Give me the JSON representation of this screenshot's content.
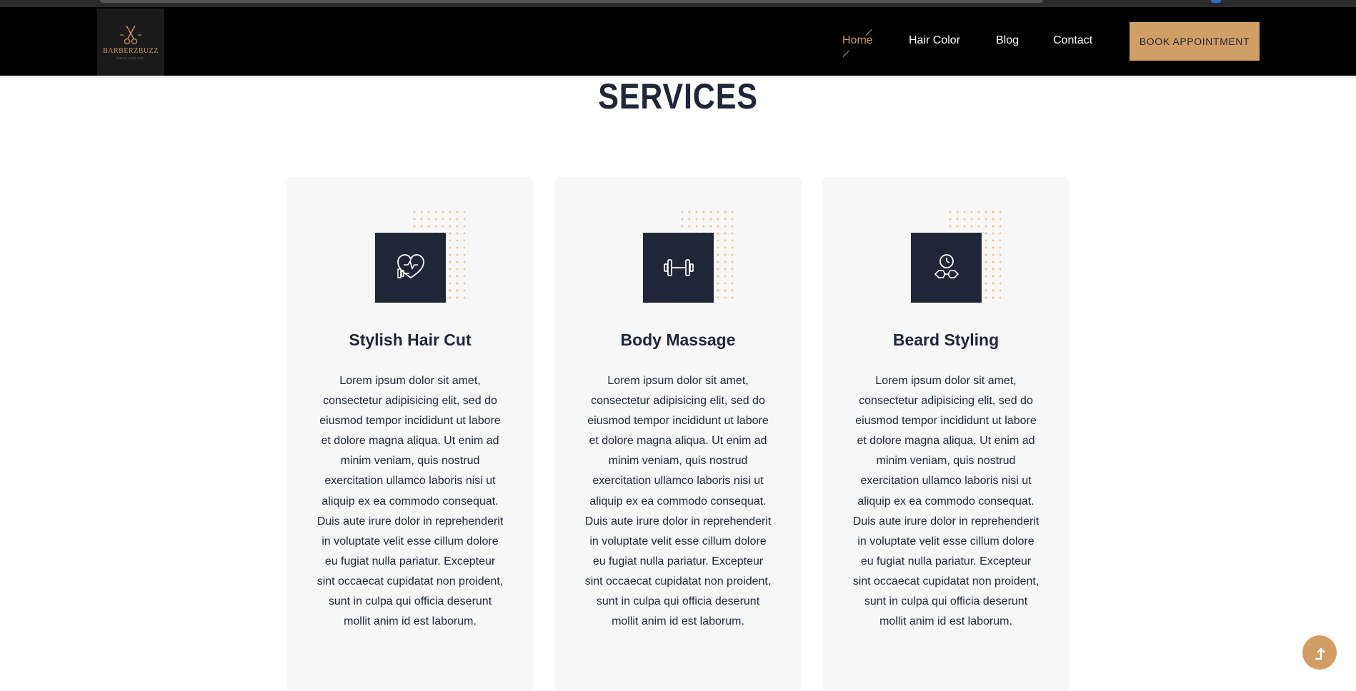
{
  "brand": {
    "name": "BARBERZBUZZ",
    "tagline": "SINCE 2020 EST."
  },
  "nav": {
    "items": [
      {
        "label": "Home",
        "active": true
      },
      {
        "label": "Hair Color",
        "active": false
      },
      {
        "label": "Blog",
        "active": false
      },
      {
        "label": "Contact",
        "active": false
      }
    ],
    "cta": "BOOK APPOINTMENT"
  },
  "services": {
    "title": "SERVICES",
    "cards": [
      {
        "icon": "heart-dumbbell-icon",
        "title": "Stylish Hair Cut",
        "text": "Lorem ipsum dolor sit amet, consectetur adipisicing elit, sed do eiusmod tempor incididunt ut labore et dolore magna aliqua. Ut enim ad minim veniam, quis nostrud exercitation ullamco laboris nisi ut aliquip ex ea commodo consequat. Duis aute irure dolor in reprehenderit in voluptate velit esse cillum dolore eu fugiat nulla pariatur. Excepteur sint occaecat cupidatat non proident, sunt in culpa qui officia deserunt mollit anim id est laborum."
      },
      {
        "icon": "dumbbell-icon",
        "title": "Body Massage",
        "text": "Lorem ipsum dolor sit amet, consectetur adipisicing elit, sed do eiusmod tempor incididunt ut labore et dolore magna aliqua. Ut enim ad minim veniam, quis nostrud exercitation ullamco laboris nisi ut aliquip ex ea commodo consequat. Duis aute irure dolor in reprehenderit in voluptate velit esse cillum dolore eu fugiat nulla pariatur. Excepteur sint occaecat cupidatat non proident, sunt in culpa qui officia deserunt mollit anim id est laborum."
      },
      {
        "icon": "stopwatch-dumbbell-icon",
        "title": "Beard Styling",
        "text": "Lorem ipsum dolor sit amet, consectetur adipisicing elit, sed do eiusmod tempor incididunt ut labore et dolore magna aliqua. Ut enim ad minim veniam, quis nostrud exercitation ullamco laboris nisi ut aliquip ex ea commodo consequat. Duis aute irure dolor in reprehenderit in voluptate velit esse cillum dolore eu fugiat nulla pariatur. Excepteur sint occaecat cupidatat non proident, sunt in culpa qui officia deserunt mollit anim id est laborum."
      }
    ]
  },
  "scroll_top": {
    "icon": "arrow-up-icon"
  },
  "colors": {
    "accent": "#d19e66",
    "dark": "#1f2637",
    "header_bg": "#000000",
    "card_bg": "#f7f7f7"
  }
}
